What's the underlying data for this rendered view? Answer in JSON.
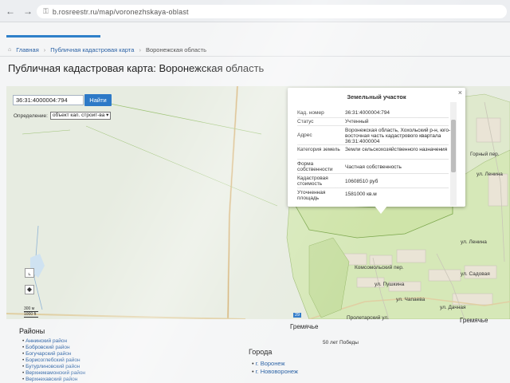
{
  "browser": {
    "url": "b.rosreestr.ru/map/voronezhskaya-oblast",
    "back_icon": "arrow-left",
    "forward_icon": "arrow-right",
    "reload_icon": "reload"
  },
  "breadcrumb": [
    "Главная",
    "Публичная кадастровая карта",
    "Воронежская область"
  ],
  "page_title": "Публичная кадастровая карта: Воронежская область",
  "search": {
    "value": "36:31:4000004:794",
    "button": "Найти"
  },
  "definition": {
    "label": "Определение:",
    "selected": "объект кап. строит-ва"
  },
  "map_tools": {
    "tool1": "⌞",
    "tool2": "◆"
  },
  "scale": [
    "300 м",
    "1000 ft"
  ],
  "map_labels": {
    "l1": "Горный пер.",
    "l2": "ул. Ленина",
    "l3": "ул. Ленина",
    "l4": "Комсомольский пер.",
    "l5": "ул. Пушкина",
    "l6": "ул. Чапаева",
    "l7": "Пролетарский ул.",
    "l8": "ул. Дачная",
    "l9": "Гремячье",
    "l10": "Гремячье",
    "l11": "50 лет Победы",
    "l12": "ул. Садовая"
  },
  "road_marker": "29",
  "popup": {
    "title": "Земельный участок",
    "close": "×",
    "rows": [
      {
        "k": "Кад. номер",
        "v": "36:31:4000004:794"
      },
      {
        "k": "Статус",
        "v": "Учтенный"
      },
      {
        "k": "Адрес",
        "v": "Воронежская область, Хохольский р-н, юго-восточная часть кадастрового квартала 36:31:4000004"
      },
      {
        "k": "Категория земель",
        "v": "Земли сельскохозяйственного назначения"
      },
      {
        "k": "Форма собственности",
        "v": "Частная собственность"
      },
      {
        "k": "Кадастровая стоимость",
        "v": "10608510 руб"
      },
      {
        "k": "Уточненная площадь",
        "v": "1581000 кв.м"
      }
    ]
  },
  "districts": {
    "title": "Районы",
    "items": [
      "Аннинский район",
      "Бобровский район",
      "Богучарский район",
      "Борисоглебский район",
      "Бутурлиновский район",
      "Верхнемамонский район",
      "Верхнехавский район"
    ]
  },
  "cities": {
    "title": "Города",
    "items": [
      "г. Воронеж",
      "г. Нововоронеж"
    ]
  },
  "colors": {
    "accent": "#2d79c7",
    "link": "#2b62a5",
    "map_bg": "#e7ece1",
    "parcel_fill": "#d6e8b8"
  }
}
